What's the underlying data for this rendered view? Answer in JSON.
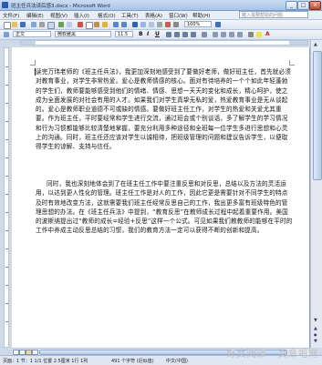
{
  "window": {
    "title": "班主任兵法读后感3.docx - Microsoft Word",
    "minimize_glyph": "_",
    "maximize_glyph": "□",
    "close_glyph": "x"
  },
  "menu": {
    "items": [
      "文件(F)",
      "编辑(E)",
      "视图(V)",
      "插入(I)",
      "格式(O)",
      "工具(T)",
      "表格(A)",
      "窗口(W)",
      "帮助(H)"
    ],
    "help_placeholder": "键入需要帮助的问题"
  },
  "toolbar2": {
    "style_value": "正文",
    "font_value": "微软雅黑",
    "size_value": "11.5",
    "bold_glyph": "B",
    "italic_glyph": "I",
    "underline_glyph": "U",
    "font_color_glyph": "A"
  },
  "document": {
    "paragraph1": "读完万玮老师的《班主任兵法》，我更加深刻地感受到了要做好老师，做好班主任，首先就必须对教育事业，对学生非常热爱。爱心是教师情感的核心。面对有待培养的一个个如此年轻蓬勃的学生们，教师要能够感受到他们的情绪、情感、思想一天天的变化和成长，精心呵护，使之成为全面发展的对社会有用的人才。如果我们对学生真挚无私的爱，热爱教育事业是无从谈起的。爱心是教师职业道德不可或缺的情感。要做好班主任工作，对学生的热爱和关爱尤其重要。作为班主任，平时要经常和学生进行交流，通过班会或个别谈话，多了解学生的学习情况和行为习惯都能够比较清楚地掌握，要充分利用多种途径和全班每一位学生多进行思想和心灵上的沟通。同时，班主任还应该对学生以诚相待，把班级管理的问题和建议告诉学生，以便取得学生的谅解、支持与信任。",
    "paragraph2": "同时，我也深刻地体会到了在班主任工作中要注重反思和对反思，总结以及方法的灵活运用，以达到更人性化的管理。班主任工作是对人的工作，因此它更是需要针对不同学生的特点及时有效地改变方法，这就需要我们班主任经常反思自己的工作，我出更多富有班级特色的管理思想的办法。在《班主任兵法》中提到，“教育反思”在教师成长过程中起着重要作用。美国的波斯纳提出过“教师的成长=经验+反思”这样一个公式。可见如果我们教教师的能够在平时的工作中养成主动反思总结的习惯，我们的教育方法一定可以获得不断的创新和提高。"
  },
  "status": {
    "page_info": "页面：1 节：1 1/1 位置 2.5厘米 1行 1列",
    "word_count": "491 个字符 (近似值)",
    "lang": "中文(中国)"
  },
  "watermark": "好文阅读 · 文章吧网",
  "colors": {
    "accent": "#2a5db0",
    "titlebar": "#a9c4e8"
  }
}
